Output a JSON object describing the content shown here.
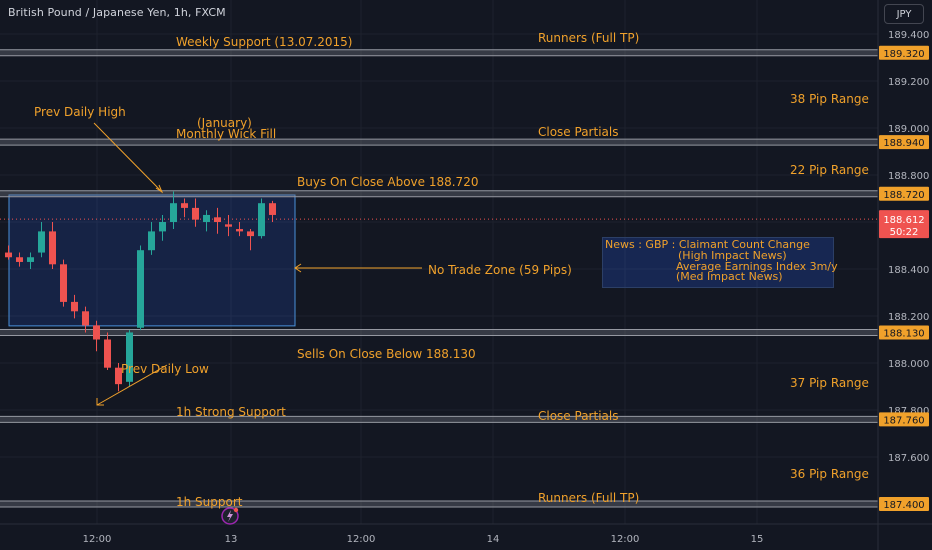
{
  "header": {
    "symbol_title": "British Pound / Japanese Yen, 1h, FXCM",
    "currency_label": "JPY"
  },
  "colors": {
    "background": "#131722",
    "bull": "#26a69a",
    "bear": "#ef5350",
    "annotation": "#f0a12b",
    "level_line": "#787b86",
    "grid": "#1e222d",
    "zone_border": "#4a90d9"
  },
  "chart_data": {
    "type": "candlestick",
    "y_axis": {
      "ylim": [
        187.3,
        189.5
      ],
      "tick_labels": [
        "189.400",
        "189.200",
        "189.000",
        "188.800",
        "188.600",
        "188.400",
        "188.200",
        "188.000",
        "187.800",
        "187.600"
      ],
      "ticks": [
        189.4,
        189.2,
        189.0,
        188.8,
        188.6,
        188.4,
        188.2,
        188.0,
        187.8,
        187.6
      ]
    },
    "x_axis": {
      "tick_labels": [
        "12:00",
        "13",
        "12:00",
        "14",
        "12:00",
        "15"
      ]
    },
    "grid": true,
    "current_price": {
      "value": 188.612,
      "label": "188.612",
      "countdown": "50:22"
    },
    "candles": [
      {
        "o": 188.47,
        "h": 188.5,
        "l": 188.44,
        "c": 188.45
      },
      {
        "o": 188.45,
        "h": 188.47,
        "l": 188.41,
        "c": 188.43
      },
      {
        "o": 188.43,
        "h": 188.47,
        "l": 188.4,
        "c": 188.45
      },
      {
        "o": 188.47,
        "h": 188.6,
        "l": 188.45,
        "c": 188.56
      },
      {
        "o": 188.56,
        "h": 188.6,
        "l": 188.4,
        "c": 188.42
      },
      {
        "o": 188.42,
        "h": 188.44,
        "l": 188.24,
        "c": 188.26
      },
      {
        "o": 188.26,
        "h": 188.29,
        "l": 188.19,
        "c": 188.22
      },
      {
        "o": 188.22,
        "h": 188.24,
        "l": 188.13,
        "c": 188.16
      },
      {
        "o": 188.16,
        "h": 188.18,
        "l": 188.05,
        "c": 188.1
      },
      {
        "o": 188.1,
        "h": 188.13,
        "l": 187.97,
        "c": 187.98
      },
      {
        "o": 187.98,
        "h": 188.0,
        "l": 187.88,
        "c": 187.91
      },
      {
        "o": 187.92,
        "h": 188.14,
        "l": 187.9,
        "c": 188.13
      },
      {
        "o": 188.15,
        "h": 188.5,
        "l": 188.14,
        "c": 188.48
      },
      {
        "o": 188.48,
        "h": 188.6,
        "l": 188.46,
        "c": 188.56
      },
      {
        "o": 188.56,
        "h": 188.63,
        "l": 188.52,
        "c": 188.6
      },
      {
        "o": 188.6,
        "h": 188.73,
        "l": 188.57,
        "c": 188.68
      },
      {
        "o": 188.68,
        "h": 188.7,
        "l": 188.62,
        "c": 188.66
      },
      {
        "o": 188.66,
        "h": 188.7,
        "l": 188.58,
        "c": 188.61
      },
      {
        "o": 188.6,
        "h": 188.65,
        "l": 188.56,
        "c": 188.63
      },
      {
        "o": 188.62,
        "h": 188.66,
        "l": 188.55,
        "c": 188.6
      },
      {
        "o": 188.59,
        "h": 188.63,
        "l": 188.54,
        "c": 188.58
      },
      {
        "o": 188.57,
        "h": 188.6,
        "l": 188.54,
        "c": 188.56
      },
      {
        "o": 188.56,
        "h": 188.57,
        "l": 188.48,
        "c": 188.54
      },
      {
        "o": 188.54,
        "h": 188.7,
        "l": 188.53,
        "c": 188.68
      },
      {
        "o": 188.68,
        "h": 188.69,
        "l": 188.6,
        "c": 188.63
      }
    ],
    "levels": [
      {
        "price": 189.32,
        "label": "189.320"
      },
      {
        "price": 188.94,
        "label": "188.940"
      },
      {
        "price": 188.72,
        "label": "188.720"
      },
      {
        "price": 188.13,
        "label": "188.130"
      },
      {
        "price": 187.76,
        "label": "187.760"
      },
      {
        "price": 187.4,
        "label": "187.400"
      }
    ],
    "no_trade_zone": {
      "top": 188.715,
      "bottom": 188.158
    },
    "annotations": {
      "weekly_support": "Weekly Support (13.07.2015)",
      "runners_top": "Runners (Full TP)",
      "range_38": "38 Pip Range",
      "prev_daily_high": "Prev Daily High",
      "january": "(January)",
      "monthly_wick": "Monthly Wick Fill",
      "close_partials_top": "Close Partials",
      "range_22": "22 Pip Range",
      "buys_on_close": "Buys On Close Above 188.720",
      "no_trade_zone": "No Trade Zone (59 Pips)",
      "sells_on_close": "Sells On Close Below 188.130",
      "prev_daily_low": "Prev Daily Low",
      "range_37": "37 Pip Range",
      "strong_support": "1h Strong Support",
      "close_partials_bottom": "Close Partials",
      "range_36": "36 Pip Range",
      "support_1h": "1h Support",
      "runners_bottom": "Runners (Full TP)"
    }
  },
  "news": {
    "line1": "News : GBP : Claimant Count Change",
    "line2": "(High Impact News)",
    "line3": "Average Earnings Index 3m/y",
    "line4": "(Med Impact News)"
  }
}
